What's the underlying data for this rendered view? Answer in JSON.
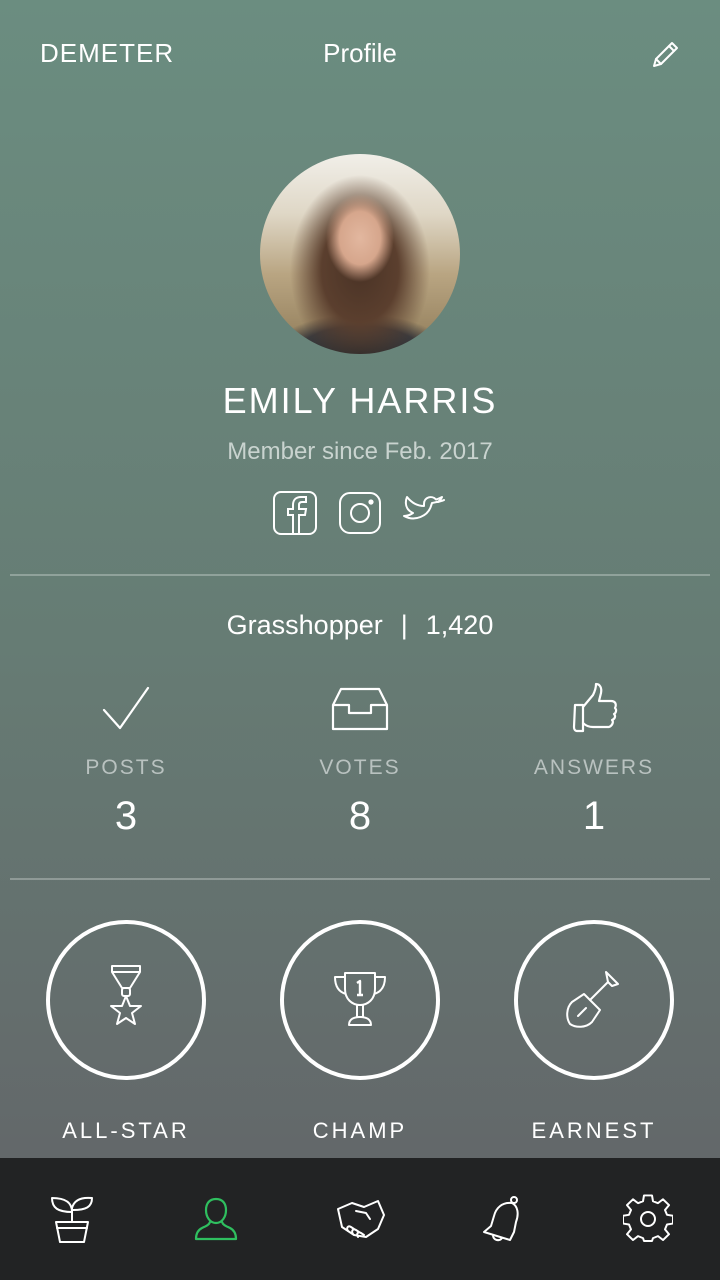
{
  "header": {
    "brand": "DEMETER",
    "title": "Profile",
    "edit_icon": "pencil-icon"
  },
  "profile": {
    "name": "EMILY HARRIS",
    "member_since": "Member since Feb. 2017",
    "socials": [
      "facebook-icon",
      "instagram-icon",
      "twitter-icon"
    ]
  },
  "rank": {
    "level": "Grasshopper",
    "separator": "|",
    "points": "1,420"
  },
  "stats": [
    {
      "label": "POSTS",
      "value": "3",
      "icon": "checkmark-icon"
    },
    {
      "label": "VOTES",
      "value": "8",
      "icon": "inbox-tray-icon"
    },
    {
      "label": "ANSWERS",
      "value": "1",
      "icon": "thumbs-up-icon"
    }
  ],
  "badges": [
    {
      "label": "ALL-STAR",
      "icon": "star-medal-icon"
    },
    {
      "label": "CHAMP",
      "icon": "trophy-icon"
    },
    {
      "label": "EARNEST",
      "icon": "shovel-icon"
    }
  ],
  "tabbar": {
    "active_color": "#2fbf5f",
    "items": [
      "plant-pot-icon",
      "person-icon",
      "handshake-icon",
      "bell-icon",
      "gear-icon"
    ],
    "active_index": 1
  },
  "colors": {
    "bg_top": "#6b8d80",
    "bg_bottom": "#62666a",
    "tabbar": "#222324"
  }
}
